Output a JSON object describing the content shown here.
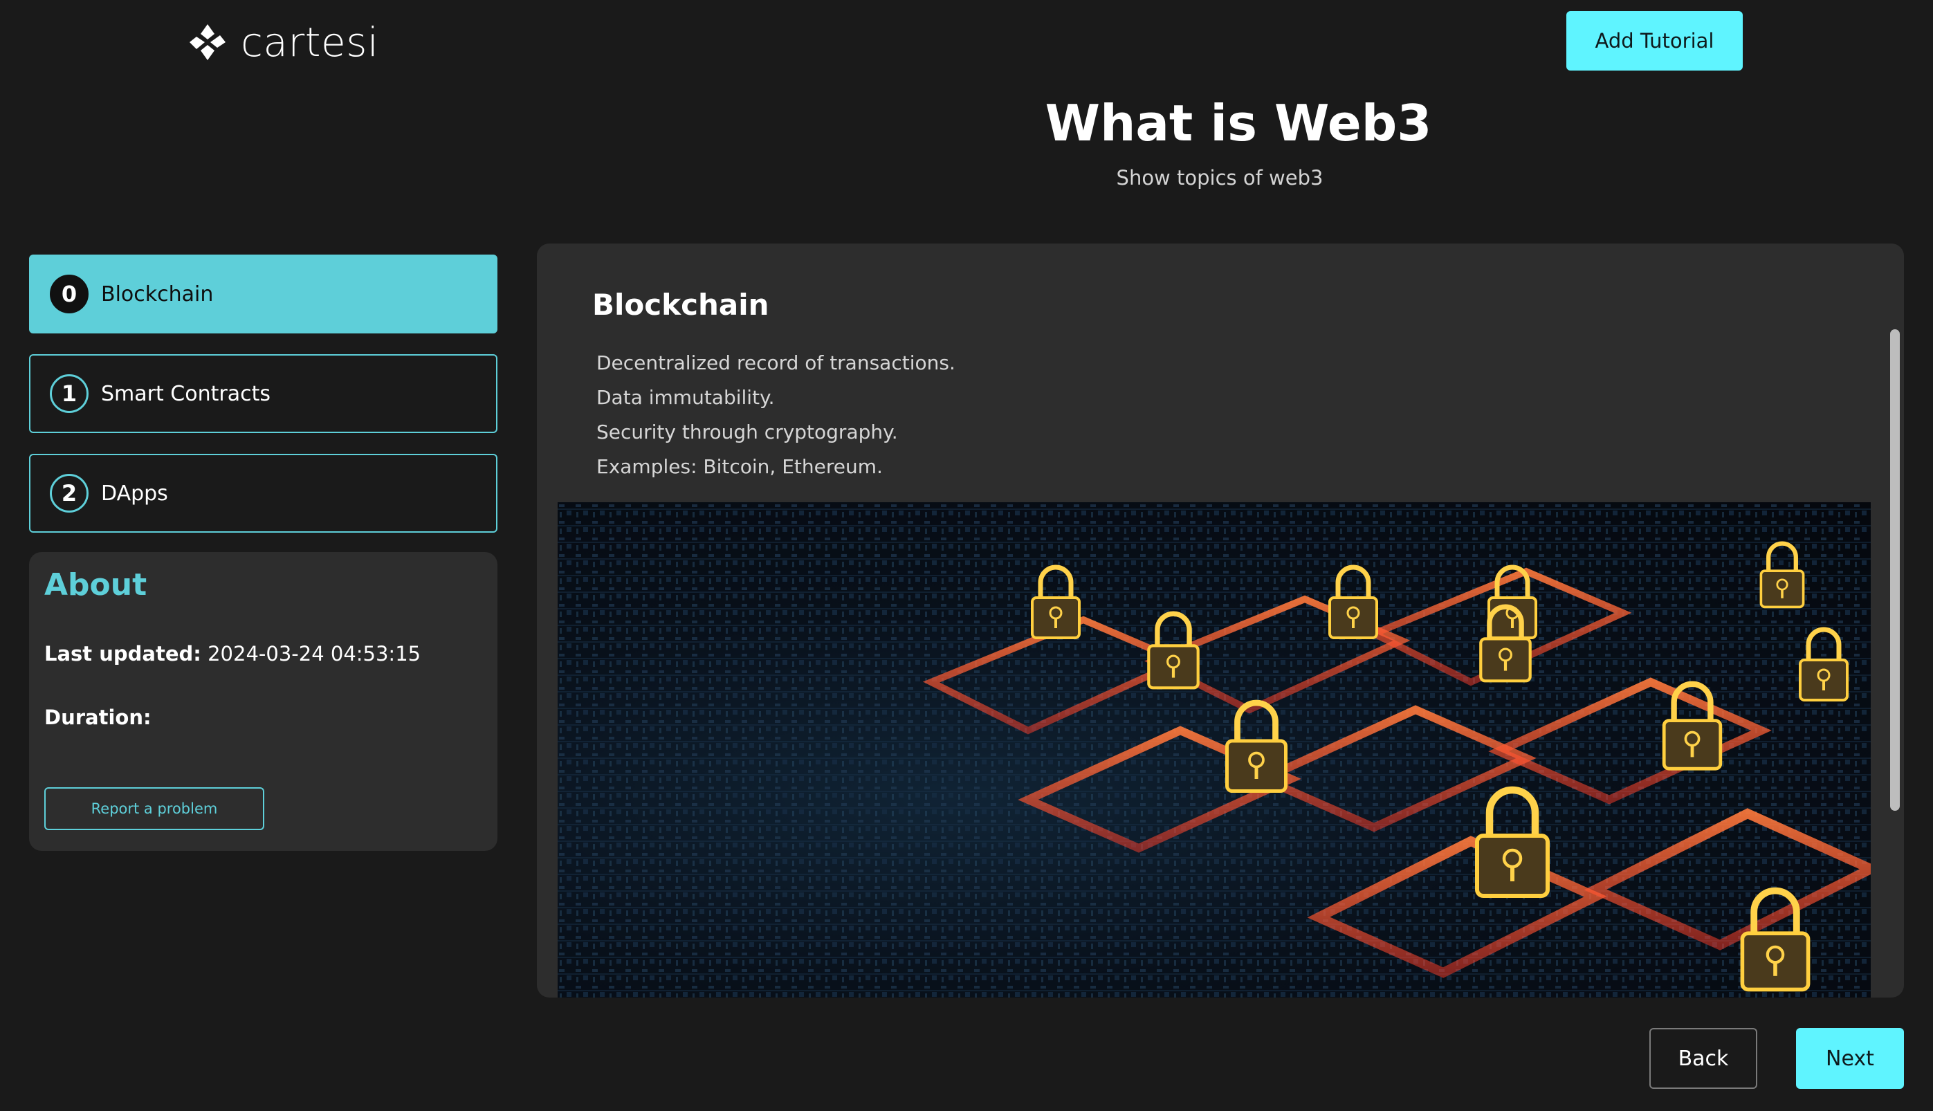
{
  "header": {
    "logo_text": "cartesi",
    "add_tutorial_label": "Add Tutorial",
    "title": "What is Web3",
    "subtitle": "Show topics of web3"
  },
  "steps": [
    {
      "number": "0",
      "label": "Blockchain",
      "active": true
    },
    {
      "number": "1",
      "label": "Smart Contracts",
      "active": false
    },
    {
      "number": "2",
      "label": "DApps",
      "active": false
    }
  ],
  "about": {
    "title": "About",
    "last_updated_label": "Last updated:",
    "last_updated_value": "2024-03-24 04:53:15",
    "duration_label": "Duration:",
    "duration_value": "",
    "report_label": "Report a problem"
  },
  "content": {
    "title": "Blockchain",
    "lines": [
      "Decentralized record of transactions.",
      "Data immutability.",
      "Security through cryptography.",
      "Examples: Bitcoin, Ethereum."
    ],
    "image_subject": "glowing-padlocks-on-circuit-board"
  },
  "footer": {
    "back_label": "Back",
    "next_label": "Next"
  },
  "colors": {
    "background": "#1a1a1a",
    "panel": "#2d2d2d",
    "accent": "#5ecfd9",
    "cta": "#5ff4ff"
  }
}
